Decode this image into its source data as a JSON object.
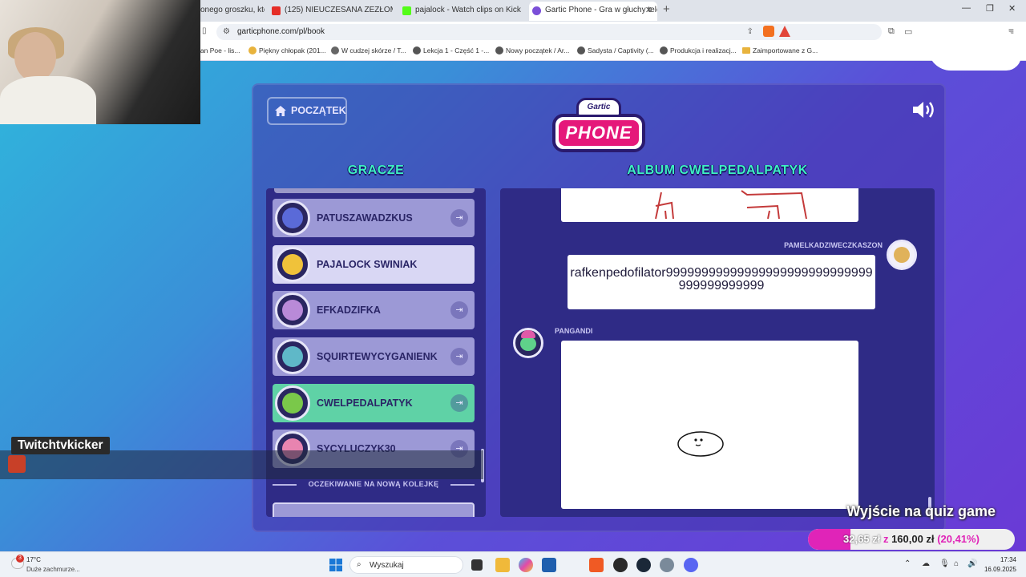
{
  "browser": {
    "tabs": [
      {
        "label": "onego groszku, któr",
        "color": "#999999"
      },
      {
        "label": "(125) NIEUCZESANA ZEZŁOMOWANI",
        "color": "#e52d27"
      },
      {
        "label": "pajalock - Watch clips on Kick",
        "color": "#53fc18"
      },
      {
        "label": "Gartic Phone - Gra w głuchy tele",
        "color": "#7b4fd8"
      }
    ],
    "url": "garticphone.com/pl/book",
    "bookmarks": [
      "lan Poe - lis...",
      "Piękny chłopak (201...",
      "W cudzej skórze / T...",
      "Lekcja 1 - Część 1 -...",
      "Nowy początek / Ar...",
      "Sadysta / Captivity (...",
      "Produkcja i realizacj...",
      "Zaimportowane z G..."
    ]
  },
  "game": {
    "home_label": "POCZĄTEK",
    "logo_top": "Gartic",
    "logo_main": "PHONE",
    "players_title": "GRACZE",
    "album_title": "ALBUM CWELPEDALPATYK",
    "players": [
      {
        "name": "PATUSZAWADZKUS",
        "avatar_color": "#5a6ad8"
      },
      {
        "name": "PAJALOCK SWINIAK",
        "avatar_color": "#f0c23a"
      },
      {
        "name": "EFKADZIFKA",
        "avatar_color": "#b98ad8"
      },
      {
        "name": "SQUIRTEWYCYGANIENK",
        "avatar_color": "#5fb8c8"
      },
      {
        "name": "CWELPEDALPATYK",
        "avatar_color": "#7ac84a"
      },
      {
        "name": "SYCYLUCZYK30",
        "avatar_color": "#e884b0"
      }
    ],
    "kick_symbol": "⇥",
    "waiting_label": "OCZEKIWANIE NA NOWĄ KOLEJKĘ",
    "album": {
      "author_1": "PAMELKADZIWECZKASZON",
      "guess_text": "rafkenpedofilator99999999999999999999999999999999999999999",
      "author_2": "PANGANDI"
    }
  },
  "overlay": {
    "twitch_label": "Twitchtvkicker",
    "goal_title": "Wyjście na quiz game",
    "goal_current": "32,65 zł",
    "goal_sep": "z",
    "goal_target": "160,00 zł",
    "goal_percent": "(20,41%)",
    "goal_fraction": 0.2041
  },
  "taskbar": {
    "weather_badge": "3",
    "temperature": "17°C",
    "weather_desc": "Duże zachmurze...",
    "search_placeholder": "Wyszukaj",
    "time": "17:34",
    "date": "16.09.2025"
  }
}
